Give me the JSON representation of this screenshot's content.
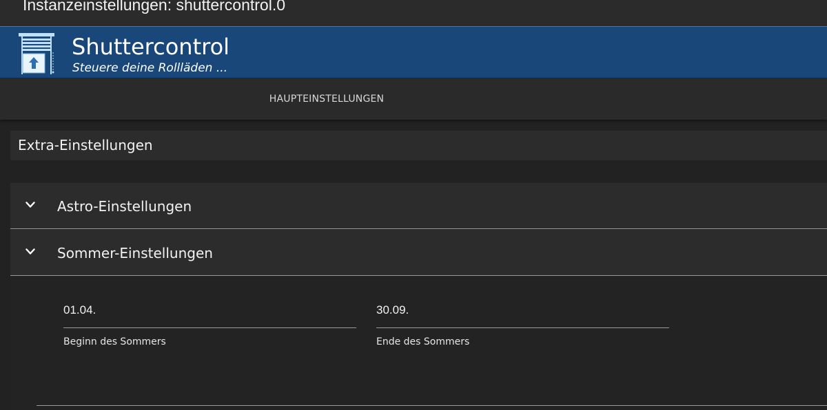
{
  "window": {
    "title": "Instanzeinstellungen: shuttercontrol.0"
  },
  "banner": {
    "title": "Shuttercontrol",
    "subtitle": "Steuere deine Rollläden ...",
    "logo_icon": "window-shutter-up-icon",
    "background": "#1a4779"
  },
  "tabs": [
    {
      "label": "HAUPTEINSTELLUNGEN",
      "icon": ""
    }
  ],
  "section": {
    "title": "Extra-Einstellungen"
  },
  "panels": [
    {
      "label": "Astro-Einstellungen",
      "icon": "chevron-down-icon"
    },
    {
      "label": "Sommer-Einstellungen",
      "icon": "chevron-down-icon"
    }
  ],
  "summer": {
    "begin": {
      "value": "01.04.",
      "label": "Beginn des Sommers"
    },
    "end": {
      "value": "30.09.",
      "label": "Ende des Sommers"
    }
  }
}
